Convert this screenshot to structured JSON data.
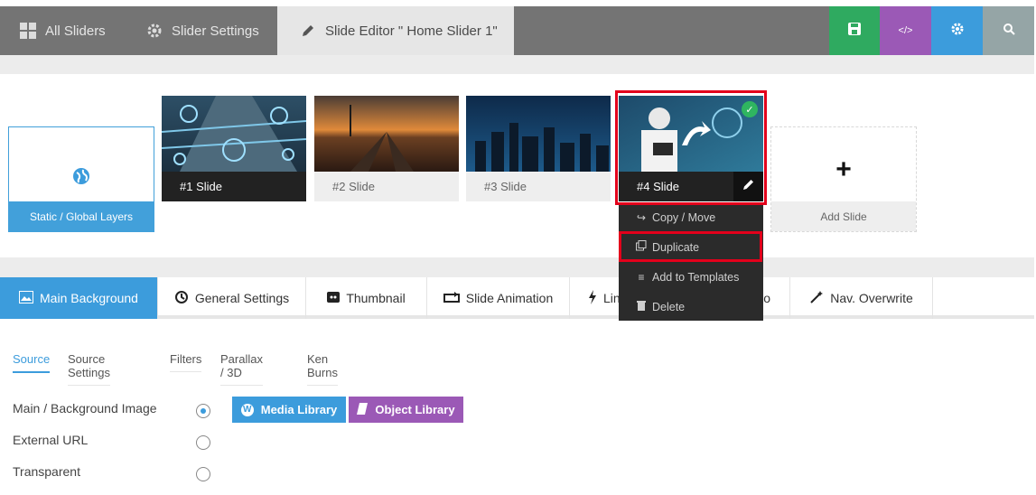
{
  "topbar": {
    "tabs": [
      {
        "label": "All Sliders",
        "icon": "grid-icon"
      },
      {
        "label": "Slider Settings",
        "icon": "gear-icon"
      },
      {
        "label": "Slide Editor \" Home Slider 1\"",
        "icon": "pencil-icon"
      }
    ],
    "buttons": [
      {
        "name": "save-button",
        "icon": "save-icon",
        "color": "#2faa60"
      },
      {
        "name": "code-button",
        "icon": "code-icon",
        "label": "</>",
        "color": "#9b59b6"
      },
      {
        "name": "settings-button",
        "icon": "gear-icon",
        "color": "#3c9cdc"
      },
      {
        "name": "search-button",
        "icon": "search-icon",
        "color": "#95a5a6"
      }
    ]
  },
  "slides": {
    "static_label": "Static / Global Layers",
    "items": [
      {
        "label": "#1 Slide"
      },
      {
        "label": "#2 Slide"
      },
      {
        "label": "#3 Slide"
      },
      {
        "label": "#4 Slide"
      }
    ],
    "add_label": "Add Slide"
  },
  "context_menu": {
    "items": [
      {
        "label": "Copy / Move",
        "icon": "share-icon"
      },
      {
        "label": "Duplicate",
        "icon": "duplicate-icon"
      },
      {
        "label": "Add to Templates",
        "icon": "list-icon"
      },
      {
        "label": "Delete",
        "icon": "trash-icon"
      }
    ]
  },
  "settings_tabs": [
    {
      "label": "Main Background",
      "icon": "image-icon"
    },
    {
      "label": "General Settings",
      "icon": "history-icon"
    },
    {
      "label": "Thumbnail",
      "icon": "thumbnail-icon"
    },
    {
      "label": "Slide Animation",
      "icon": "loop-icon"
    },
    {
      "label": "Lin",
      "icon": "bolt-icon"
    },
    {
      "label": "o",
      "icon": ""
    },
    {
      "label": "Nav. Overwrite",
      "icon": "wand-icon"
    }
  ],
  "sub_tabs": [
    "Source",
    "Source Settings",
    "Filters",
    "Parallax / 3D",
    "Ken Burns"
  ],
  "source_options": [
    {
      "label": "Main / Background Image",
      "selected": true
    },
    {
      "label": "External URL",
      "selected": false
    },
    {
      "label": "Transparent",
      "selected": false
    }
  ],
  "library_buttons": [
    {
      "label": "Media Library",
      "icon": "wordpress-icon",
      "color": "#3c9cdc"
    },
    {
      "label": "Object Library",
      "icon": "book-icon",
      "color": "#9b59b6"
    }
  ]
}
